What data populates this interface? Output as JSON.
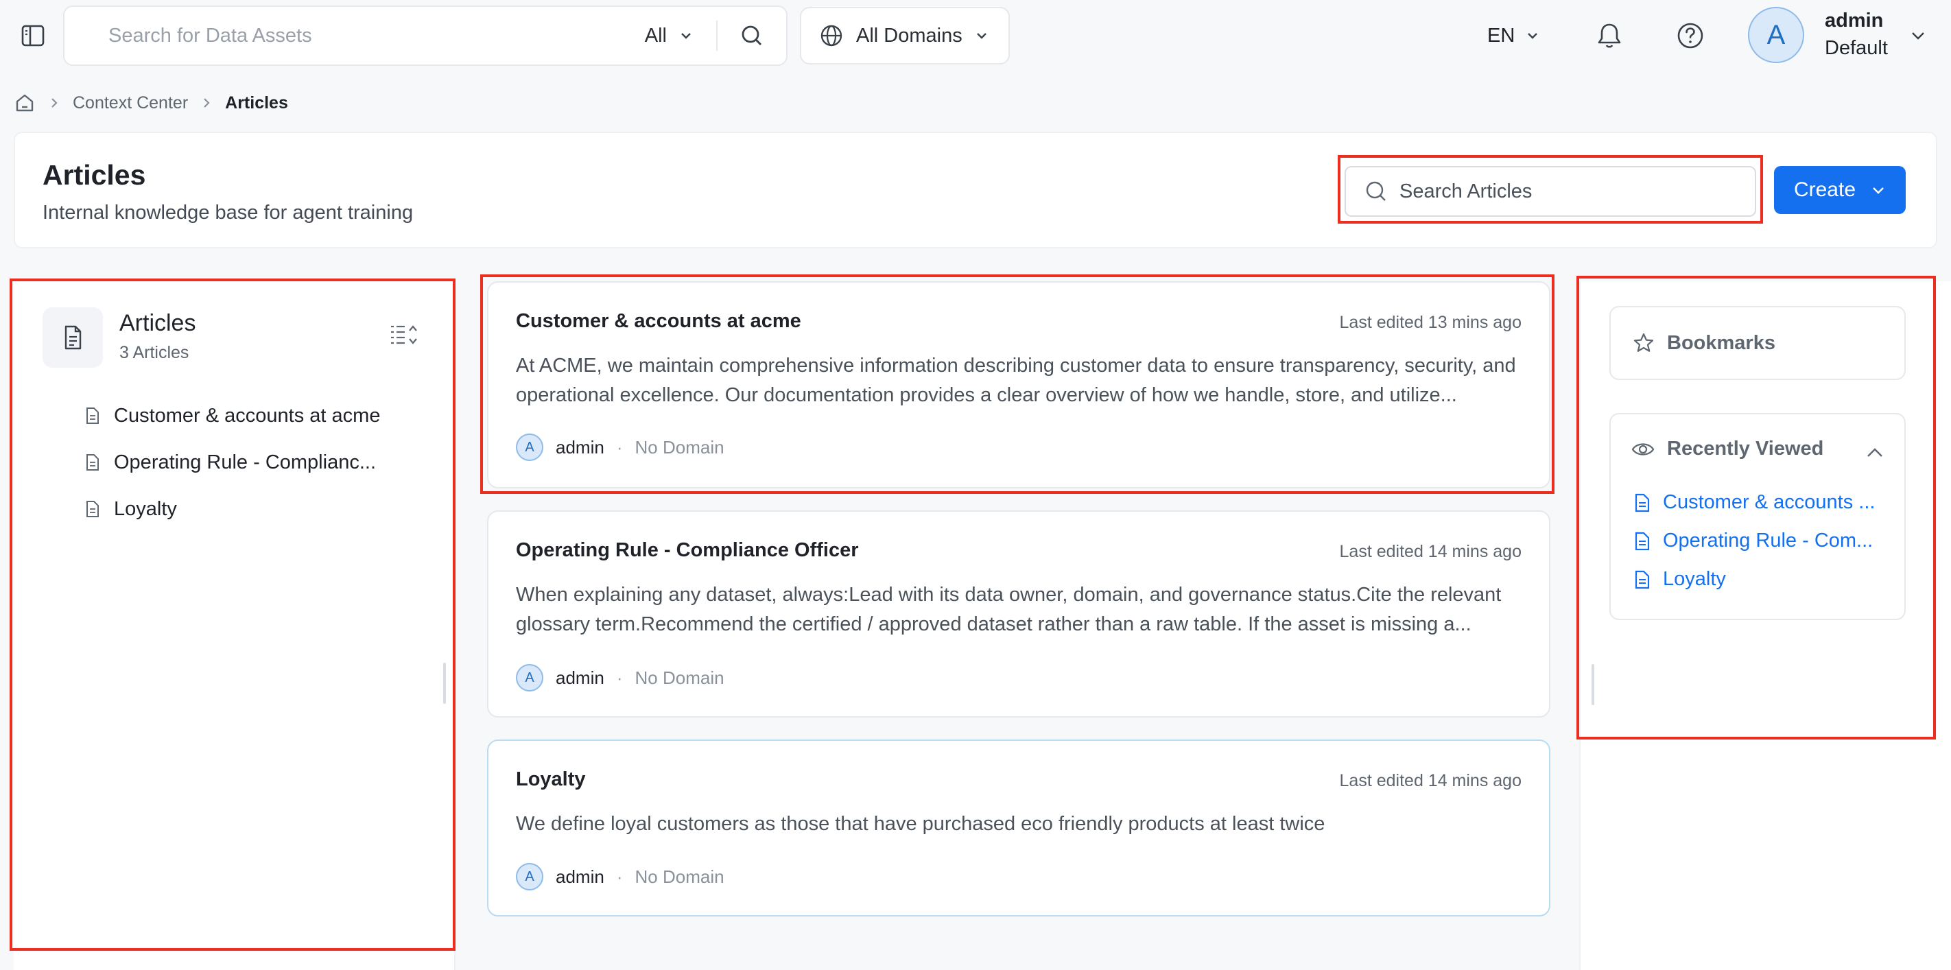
{
  "topbar": {
    "search_placeholder": "Search for Data Assets",
    "search_scope": "All",
    "domains_label": "All Domains",
    "language": "EN",
    "user": {
      "avatar_letter": "A",
      "name": "admin",
      "domain": "Default"
    }
  },
  "breadcrumb": {
    "items": [
      "Context Center",
      "Articles"
    ]
  },
  "header": {
    "title": "Articles",
    "subtitle": "Internal knowledge base for agent training",
    "search_placeholder": "Search Articles",
    "create_label": "Create"
  },
  "tree": {
    "title": "Articles",
    "count": "3 Articles",
    "items": [
      {
        "label": "Customer & accounts at acme"
      },
      {
        "label": "Operating Rule - Complianc..."
      },
      {
        "label": "Loyalty"
      }
    ]
  },
  "articles": [
    {
      "title": "Customer & accounts at acme",
      "edited": "Last edited 13 mins ago",
      "description": "At ACME, we maintain comprehensive information describing customer data to ensure transparency, security, and operational excellence. Our documentation provides a clear overview of how we handle, store, and utilize...",
      "author_initial": "A",
      "author": "admin",
      "separator": "·",
      "domain": "No Domain"
    },
    {
      "title": "Operating Rule - Compliance Officer",
      "edited": "Last edited 14 mins ago",
      "description": "When explaining any dataset, always:Lead with its data owner, domain, and governance status.Cite the relevant glossary term.Recommend the certified / approved dataset rather than a raw table. If the asset is missing a...",
      "author_initial": "A",
      "author": "admin",
      "separator": "·",
      "domain": "No Domain"
    },
    {
      "title": "Loyalty",
      "edited": "Last edited 14 mins ago",
      "description": "We define loyal customers as those that have purchased eco friendly products at least twice",
      "author_initial": "A",
      "author": "admin",
      "separator": "·",
      "domain": "No Domain"
    }
  ],
  "sidepanel": {
    "bookmarks_label": "Bookmarks",
    "recent_label": "Recently Viewed",
    "recent_items": [
      {
        "label": "Customer & accounts ..."
      },
      {
        "label": "Operating Rule - Com..."
      },
      {
        "label": "Loyalty"
      }
    ]
  },
  "colors": {
    "accent": "#1570ef",
    "highlight": "#ec2d1f",
    "page_bg": "#f7f8fa"
  }
}
